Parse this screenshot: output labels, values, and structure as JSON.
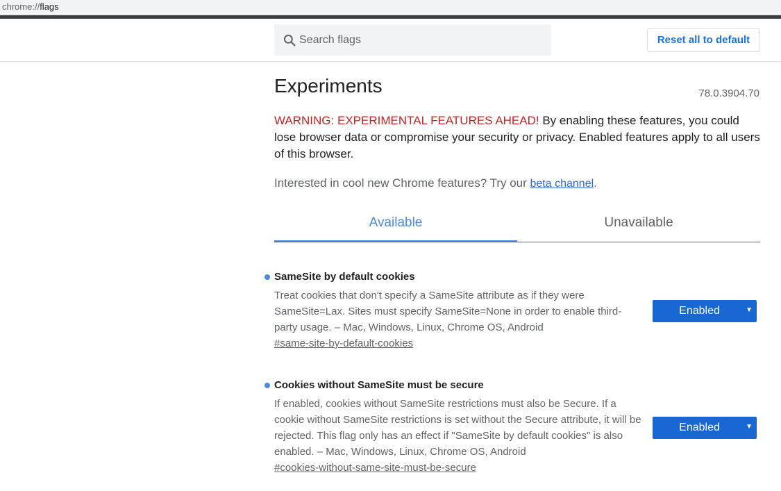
{
  "address_bar": {
    "scheme": "chrome://",
    "host": "flags"
  },
  "search": {
    "placeholder": "Search flags"
  },
  "header": {
    "reset_label": "Reset all to default"
  },
  "page": {
    "title": "Experiments",
    "version": "78.0.3904.70",
    "warning_prefix": "WARNING: EXPERIMENTAL FEATURES AHEAD!",
    "warning_body": " By enabling these features, you could lose browser data or compromise your security or privacy. Enabled features apply to all users of this browser.",
    "interest_text": "Interested in cool new Chrome features? Try our ",
    "interest_link": "beta channel",
    "interest_suffix": "."
  },
  "tabs": [
    {
      "label": "Available",
      "active": true
    },
    {
      "label": "Unavailable",
      "active": false
    }
  ],
  "experiments": [
    {
      "name": "SameSite by default cookies",
      "description": "Treat cookies that don't specify a SameSite attribute as if they were SameSite=Lax. Sites must specify SameSite=None in order to enable third-party usage. – Mac, Windows, Linux, Chrome OS, Android",
      "link": "#same-site-by-default-cookies",
      "value": "Enabled"
    },
    {
      "name": "Cookies without SameSite must be secure",
      "description": "If enabled, cookies without SameSite restrictions must also be Secure. If a cookie without SameSite restrictions is set without the Secure attribute, it will be rejected. This flag only has an effect if \"SameSite by default cookies\" is also enabled. – Mac, Windows, Linux, Chrome OS, Android",
      "link": "#cookies-without-same-site-must-be-secure",
      "value": "Enabled"
    }
  ],
  "colors": {
    "accent": "#4c89e0",
    "warning": "#c5221f",
    "select_bg": "#1967d2",
    "link": "#3367d6"
  }
}
